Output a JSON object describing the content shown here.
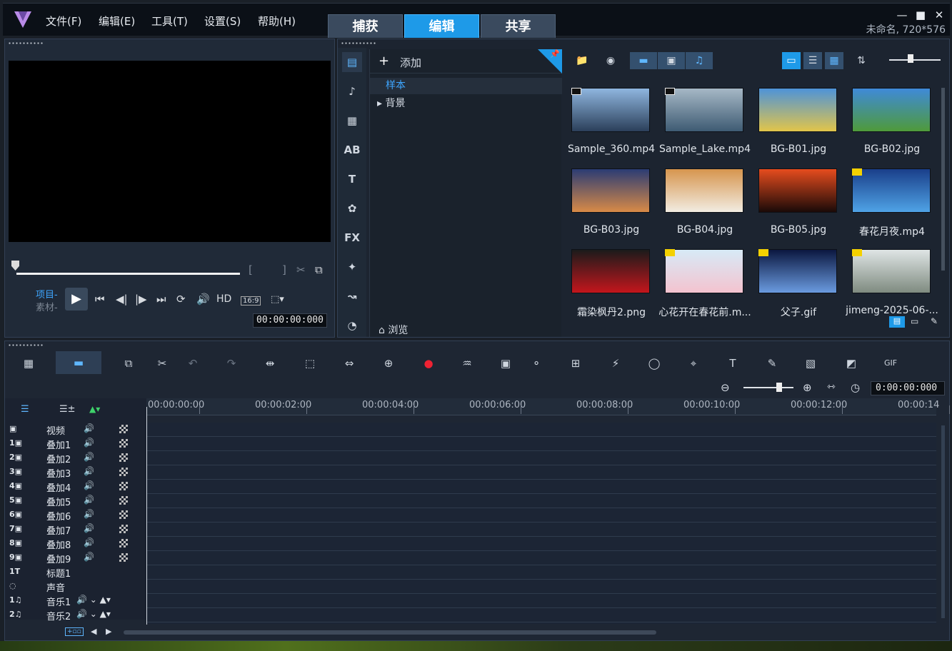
{
  "menu": [
    "文件(F)",
    "编辑(E)",
    "工具(T)",
    "设置(S)",
    "帮助(H)"
  ],
  "main_tabs": [
    "捕获",
    "编辑",
    "共享"
  ],
  "active_tab": "编辑",
  "window_controls": {
    "minimize": "—",
    "maximize": "■",
    "close": "✕"
  },
  "project_info": "未命名, 720*576",
  "player": {
    "mode_project": "项目-",
    "mode_clip": "素材-",
    "hd_label": "HD",
    "aspect": "16:9",
    "timecode": "00:00:00:000",
    "mark_in": "[",
    "mark_out": "]"
  },
  "library": {
    "add_label": "添加",
    "folders": [
      "样本",
      "背景"
    ],
    "browse_label": "浏览",
    "items": [
      {
        "name": "Sample_360.mp4",
        "type": "video",
        "colors": [
          "#8fb6df",
          "#2b3f5a"
        ]
      },
      {
        "name": "Sample_Lake.mp4",
        "type": "video",
        "colors": [
          "#a6b8c6",
          "#3e5b73"
        ]
      },
      {
        "name": "BG-B01.jpg",
        "type": "image",
        "colors": [
          "#4e93d8",
          "#e2c54a"
        ]
      },
      {
        "name": "BG-B02.jpg",
        "type": "image",
        "colors": [
          "#3f8ad8",
          "#4f9a3a"
        ]
      },
      {
        "name": "BG-B03.jpg",
        "type": "image",
        "colors": [
          "#2b3c74",
          "#d88a47"
        ]
      },
      {
        "name": "BG-B04.jpg",
        "type": "image",
        "colors": [
          "#d6954e",
          "#f2ece2"
        ]
      },
      {
        "name": "BG-B05.jpg",
        "type": "image",
        "colors": [
          "#e64c1e",
          "#1a0a08"
        ]
      },
      {
        "name": "春花月夜.mp4",
        "type": "video-y",
        "colors": [
          "#1a3f8a",
          "#4fa3e6"
        ]
      },
      {
        "name": "霜染枫丹2.png",
        "type": "image",
        "colors": [
          "#1b1b1b",
          "#c4161c"
        ]
      },
      {
        "name": "心花开在春花前.m...",
        "type": "video-y",
        "colors": [
          "#d7eaf7",
          "#f4c3cf"
        ]
      },
      {
        "name": "父子.gif",
        "type": "video-y",
        "colors": [
          "#0b1740",
          "#6a9be0"
        ]
      },
      {
        "name": "jimeng-2025-06-...",
        "type": "video-y",
        "colors": [
          "#dfe5e5",
          "#7f8b80"
        ]
      }
    ]
  },
  "timeline": {
    "timecode": "0:00:00:000",
    "ruler": [
      "00:00:00:00",
      "00:00:02:00",
      "00:00:04:00",
      "00:00:06:00",
      "00:00:08:00",
      "00:00:10:00",
      "00:00:12:00",
      "00:00:14"
    ],
    "tracks": [
      {
        "icon": "▣",
        "name": "视频",
        "kind": "video"
      },
      {
        "icon": "1▣",
        "name": "叠加1",
        "kind": "overlay"
      },
      {
        "icon": "2▣",
        "name": "叠加2",
        "kind": "overlay"
      },
      {
        "icon": "3▣",
        "name": "叠加3",
        "kind": "overlay"
      },
      {
        "icon": "4▣",
        "name": "叠加4",
        "kind": "overlay"
      },
      {
        "icon": "5▣",
        "name": "叠加5",
        "kind": "overlay"
      },
      {
        "icon": "6▣",
        "name": "叠加6",
        "kind": "overlay"
      },
      {
        "icon": "7▣",
        "name": "叠加7",
        "kind": "overlay"
      },
      {
        "icon": "8▣",
        "name": "叠加8",
        "kind": "overlay"
      },
      {
        "icon": "9▣",
        "name": "叠加9",
        "kind": "overlay"
      },
      {
        "icon": "1T",
        "name": "标题1",
        "kind": "title"
      },
      {
        "icon": "◌",
        "name": "声音",
        "kind": "voice"
      },
      {
        "icon": "1♫",
        "name": "音乐1",
        "kind": "music"
      },
      {
        "icon": "2♫",
        "name": "音乐2",
        "kind": "music"
      }
    ]
  }
}
